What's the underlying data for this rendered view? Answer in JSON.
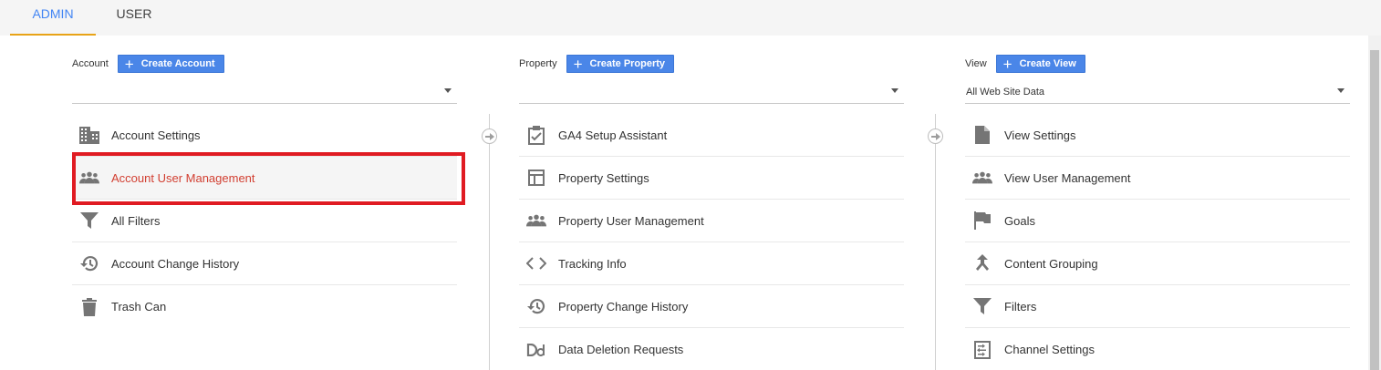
{
  "tabs": [
    {
      "label": "ADMIN"
    },
    {
      "label": "USER"
    }
  ],
  "account": {
    "label": "Account",
    "create_label": "Create Account",
    "selector_value": "",
    "items": [
      {
        "label": "Account Settings",
        "icon": "building-icon"
      },
      {
        "label": "Account User Management",
        "icon": "people-icon"
      },
      {
        "label": "All Filters",
        "icon": "filter-icon"
      },
      {
        "label": "Account Change History",
        "icon": "history-icon"
      },
      {
        "label": "Trash Can",
        "icon": "trash-icon"
      }
    ]
  },
  "property": {
    "label": "Property",
    "create_label": "Create Property",
    "selector_value": "",
    "items": [
      {
        "label": "GA4 Setup Assistant",
        "icon": "clipboard-check-icon"
      },
      {
        "label": "Property Settings",
        "icon": "layout-icon"
      },
      {
        "label": "Property User Management",
        "icon": "people-icon"
      },
      {
        "label": "Tracking Info",
        "icon": "code-icon"
      },
      {
        "label": "Property Change History",
        "icon": "history-icon"
      },
      {
        "label": "Data Deletion Requests",
        "icon": "dd-icon"
      }
    ]
  },
  "view": {
    "label": "View",
    "create_label": "Create View",
    "selector_value": "All Web Site Data",
    "items": [
      {
        "label": "View Settings",
        "icon": "document-icon"
      },
      {
        "label": "View User Management",
        "icon": "people-icon"
      },
      {
        "label": "Goals",
        "icon": "flag-icon"
      },
      {
        "label": "Content Grouping",
        "icon": "merge-icon"
      },
      {
        "label": "Filters",
        "icon": "filter-icon"
      },
      {
        "label": "Channel Settings",
        "icon": "channel-icon"
      }
    ]
  },
  "colors": {
    "accent": "#4285f4",
    "tab_underline": "#e8a317",
    "selected_text": "#d23f31",
    "highlight_box": "#e01b22"
  }
}
